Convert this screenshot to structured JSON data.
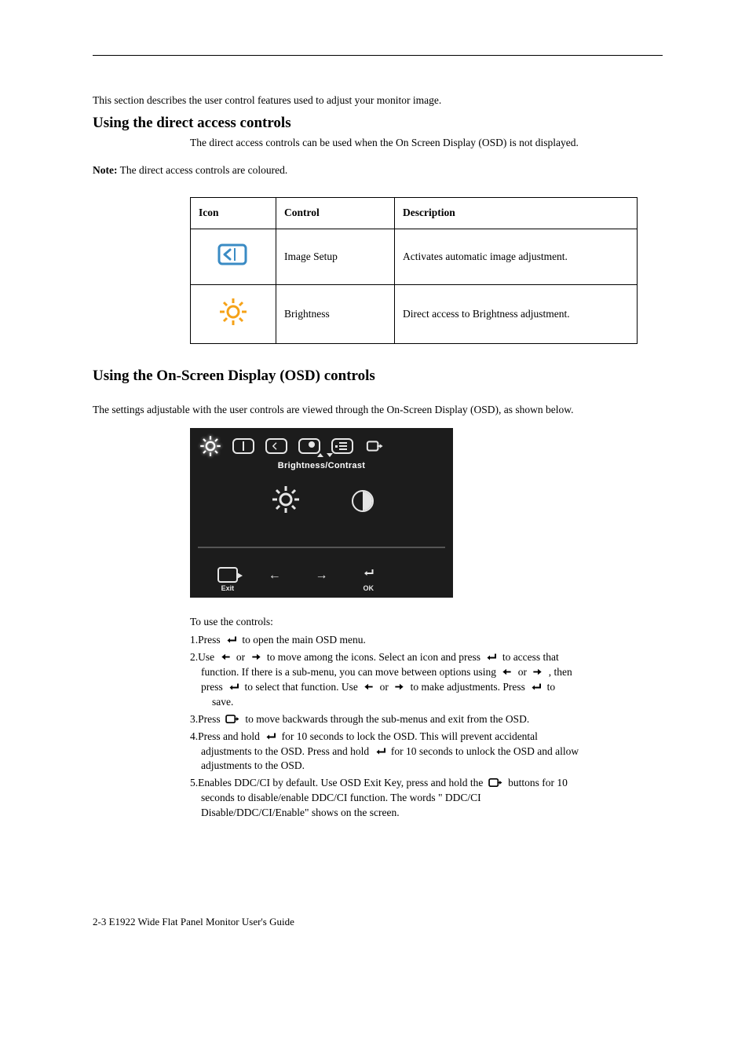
{
  "intro": "This section describes the user control features used to adjust your monitor image.",
  "section1": {
    "title": "Using the direct access controls",
    "lead": "The direct access controls can be used when the On Screen Display (OSD) is not displayed.",
    "note_label": "Note:",
    "note_text": " The direct access controls are coloured."
  },
  "table": {
    "headers": {
      "icon": "Icon",
      "control": "Control",
      "description": "Description"
    },
    "rows": [
      {
        "control": "Image Setup",
        "description": "Activates automatic image adjustment."
      },
      {
        "control": "Brightness",
        "description": "Direct access to Brightness adjustment."
      }
    ]
  },
  "section2": {
    "title": "Using the On-Screen Display (OSD) controls",
    "lead": "The settings adjustable with the user controls are viewed through the On-Screen Display (OSD), as shown below."
  },
  "osd": {
    "title": "Brightness/Contrast",
    "exit": "Exit",
    "ok": "OK"
  },
  "steps_intro": "To use the controls:",
  "steps": {
    "s1_a": "1.Press ",
    "s1_b": " to open the main OSD menu.",
    "s2_a": "2.Use ",
    "s2_b": " or ",
    "s2_c": " to move among the icons. Select an icon and press ",
    "s2_d": " to access that",
    "s2_e": "function. If there is a sub-menu, you can move between options using ",
    "s2_f": " or ",
    "s2_g": " , then",
    "s2_h": "press ",
    "s2_i": " to select that function. Use ",
    "s2_j": " or ",
    "s2_k": " to make adjustments.    Press ",
    "s2_l": " to",
    "s2_save": "save.",
    "s3_a": "3.Press ",
    "s3_b": " to move backwards through the sub-menus and exit from the OSD.",
    "s4_a": "4.Press and hold ",
    "s4_b": " for 10 seconds to lock the OSD. This will prevent accidental",
    "s4_c": "adjustments to the OSD. Press and hold ",
    "s4_d": " for 10 seconds to unlock the OSD and allow",
    "s4_e": "adjustments to the OSD.",
    "s5_a": "5.Enables DDC/CI by default. Use OSD Exit Key, press and hold the ",
    "s5_b": " buttons for 10",
    "s5_c": "seconds to disable/enable DDC/CI function. The words \" DDC/CI",
    "s5_d": "Disable/DDC/CI/Enable\" shows on the screen."
  },
  "footer": "2-3 E1922 Wide Flat Panel Monitor User's Guide"
}
